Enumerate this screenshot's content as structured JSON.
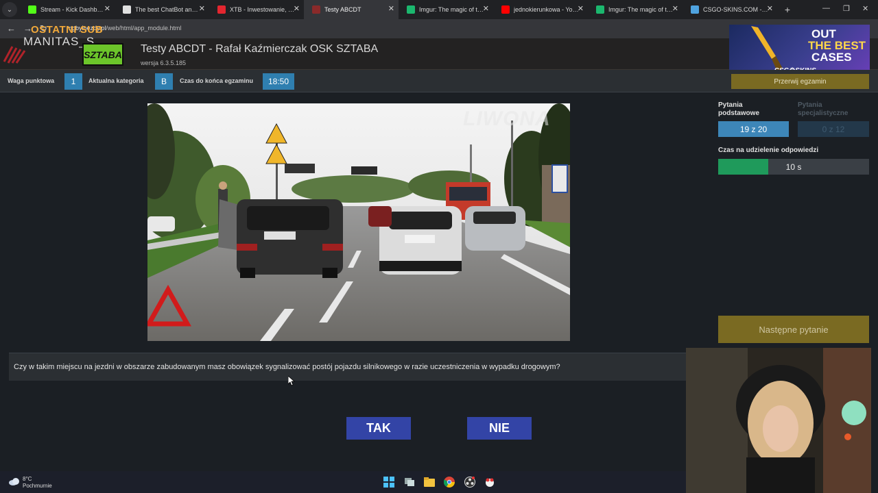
{
  "browser": {
    "tabs": [
      {
        "label": "Stream - Kick Dashboard",
        "active": false,
        "favicon_color": "#53fc18"
      },
      {
        "label": "The best ChatBot and Wi",
        "active": false,
        "favicon_color": "#e0e0e0"
      },
      {
        "label": "XTB - Inwestowanie, Oszc",
        "active": false,
        "favicon_color": "#e3262f"
      },
      {
        "label": "Testy ABCDT",
        "active": true,
        "favicon_color": "#8a2a2a"
      },
      {
        "label": "Imgur: The magic of the I",
        "active": false,
        "favicon_color": "#1bb76e"
      },
      {
        "label": "jednokierunkowa - YouTu",
        "active": false,
        "favicon_color": "#ff0000"
      },
      {
        "label": "Imgur: The magic of the I",
        "active": false,
        "favicon_color": "#1bb76e"
      },
      {
        "label": "CSGO-SKINS.COM - Najle",
        "active": false,
        "favicon_color": "#4fa3e0"
      }
    ],
    "close_glyph": "✕",
    "new_tab_glyph": "+",
    "url_domain": "ngbyinezdy.pl",
    "url_path": "/web/html/app_module.html"
  },
  "stream_overlay": {
    "brand": "OSTATNI SUB",
    "handle": "MANITAS_S"
  },
  "app": {
    "logo_text": "SZTABA",
    "title": "Testy ABCDT - Rafał Kaźmierczak OSK SZTABA",
    "version": "wersja 6.3.5.185"
  },
  "ad": {
    "line1": "OUT",
    "line2": "THE BEST",
    "line3": "CASES",
    "brand": "CSG⚙SKINS"
  },
  "status": {
    "weight_label": "Waga punktowa",
    "weight_value": "1",
    "category_label": "Aktualna kategoria",
    "category_value": "B",
    "time_label": "Czas do końca egzaminu",
    "time_value": "18:50",
    "abort_label": "Przerwij egzamin"
  },
  "panel": {
    "basic_label_1": "Pytania",
    "basic_label_2": "podstawowe",
    "special_label_1": "Pytania",
    "special_label_2": "specjalistyczne",
    "basic_count": "19 z 20",
    "special_count": "0 z 12",
    "answer_time_label": "Czas na udzielenie odpowiedzi",
    "answer_time_value": "10 s",
    "answer_time_fraction": 0.33,
    "next_label": "Następne pytanie"
  },
  "scene": {
    "watermark": "LIWONA"
  },
  "question": {
    "text": "Czy w takim miejscu na jezdni w obszarze zabudowanym masz obowiązek sygnalizować postój pojazdu silnikowego w razie uczestniczenia w wypadku drogowym?",
    "yes": "TAK",
    "no": "NIE"
  },
  "taskbar": {
    "weather_temp": "8°C",
    "weather_desc": "Pochmurnie"
  }
}
